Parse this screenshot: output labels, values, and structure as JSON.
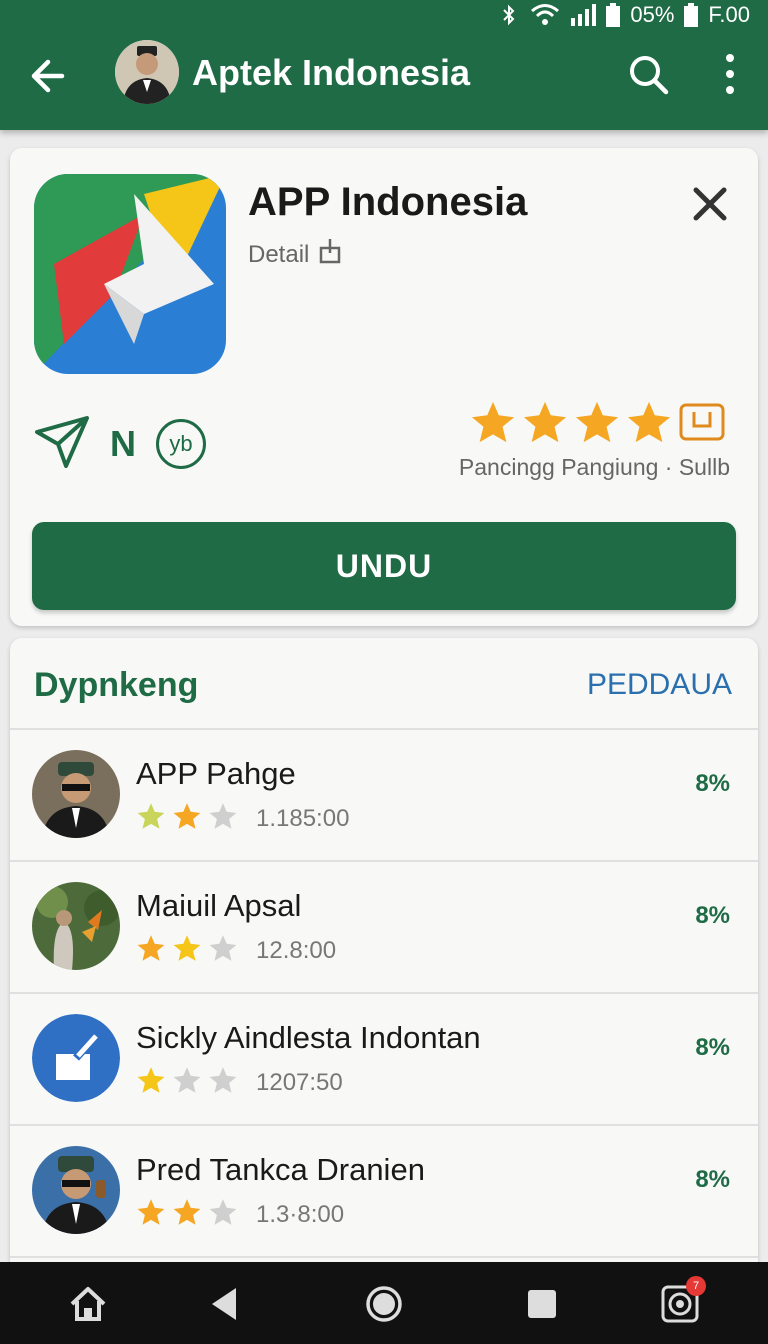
{
  "status_bar": {
    "battery_text": "05%",
    "time": "F.00",
    "icons": [
      "bluetooth-icon",
      "wifi-icon",
      "signal-icon",
      "battery-icon"
    ]
  },
  "app_bar": {
    "title": "Aptek Indonesia",
    "icons": [
      "back-arrow-icon",
      "search-icon",
      "more-vert-icon"
    ]
  },
  "app_card": {
    "name": "APP Indonesia",
    "detail_label": "Detail",
    "badge_letter": "N",
    "badge_circle": "yb",
    "rating_stars": 4,
    "rating_caption": "Pancingg Pangiung · Sullb",
    "install_label": "UNDU"
  },
  "list": {
    "title": "Dypnkeng",
    "action_label": "PEDDAUA",
    "items": [
      {
        "name": "APP Pahge",
        "stars": 2,
        "count": "1.185:00",
        "pct": "8%"
      },
      {
        "name": "Maiuil Apsal",
        "stars": 2,
        "count": "12.8:00",
        "pct": "8%"
      },
      {
        "name": "Sickly Aindlesta Indontan",
        "stars": 1,
        "count": "1207:50",
        "pct": "8%"
      },
      {
        "name": "Pred Tankca Dranien",
        "stars": 2,
        "count": "1.3·8:00",
        "pct": "8%"
      }
    ]
  },
  "nav_bar": {
    "icons": [
      "home-icon",
      "back-triangle-icon",
      "home-circle-icon",
      "recents-square-icon",
      "camera-icon"
    ],
    "notification_count": "7"
  },
  "colors": {
    "primary": "#1e6b45",
    "link": "#2a6fae",
    "star": "#f5a623"
  }
}
